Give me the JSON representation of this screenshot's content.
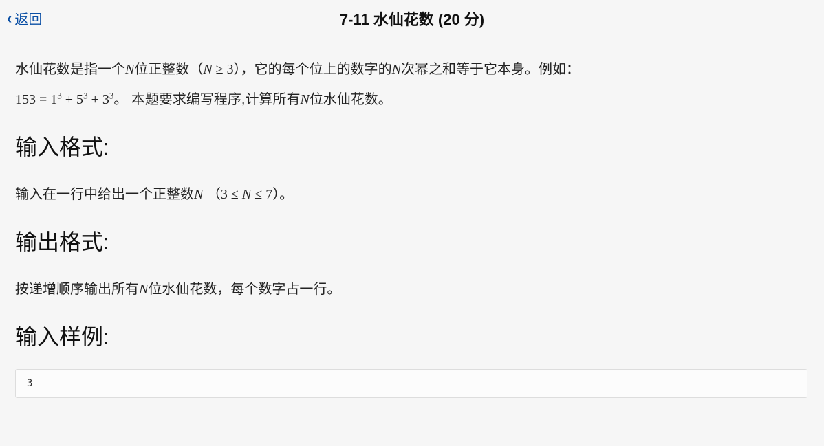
{
  "header": {
    "back_label": "返回",
    "title": "7-11 水仙花数 (20 分)"
  },
  "body": {
    "intro_part1": "水仙花数是指一个",
    "intro_N1": "N",
    "intro_part2": "位正整数（",
    "intro_cond1": "N ≥ 3",
    "intro_part3": "），它的每个位上的数字的",
    "intro_N2": "N",
    "intro_part4": "次幂之和等于它本身。例如：",
    "intro_eq": "153 = 1³ + 5³ + 3³",
    "intro_part5": "。 本题要求编写程序,计算所有",
    "intro_N3": "N",
    "intro_part6": "位水仙花数。",
    "h_input": "输入格式:",
    "input_part1": "输入在一行中给出一个正整数",
    "input_N": "N",
    "input_part2": "（",
    "input_range": "3 ≤ N ≤ 7",
    "input_part3": "）。",
    "h_output": "输出格式:",
    "output_part1": "按递增顺序输出所有",
    "output_N": "N",
    "output_part2": "位水仙花数，每个数字占一行。",
    "h_sample_in": "输入样例:",
    "sample_in": "3"
  }
}
